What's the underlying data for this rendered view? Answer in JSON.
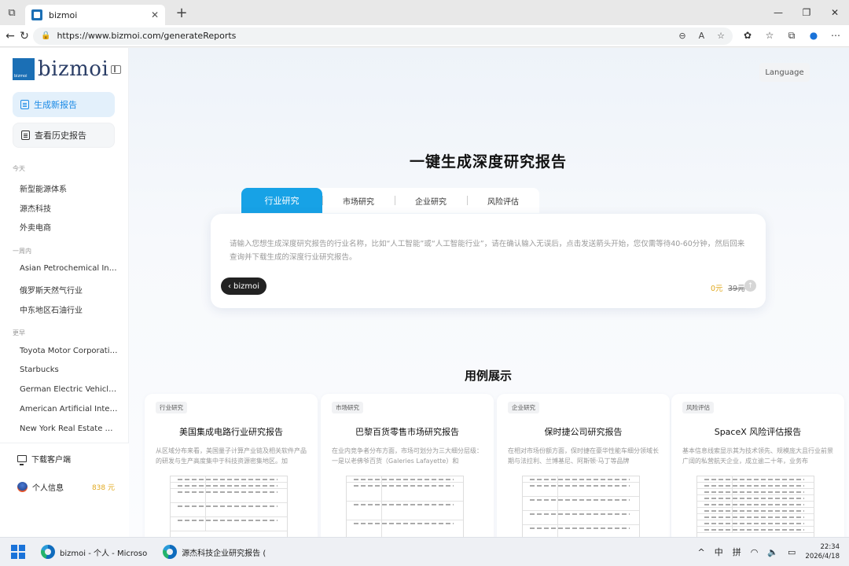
{
  "browser": {
    "tab_title": "bizmoi",
    "url": "https://www.bizmoi.com/generateReports"
  },
  "sidebar": {
    "logo_text": "bizmoi",
    "generate_button": "生成新报告",
    "history_button": "查看历史报告",
    "groups": [
      {
        "heading": "今天",
        "items": [
          "新型能源体系",
          "源杰科技",
          "外卖电商"
        ]
      },
      {
        "heading": "一周内",
        "items": [
          "Asian Petrochemical Industry",
          "俄罗斯天然气行业",
          "中东地区石油行业"
        ]
      },
      {
        "heading": "更早",
        "items": [
          "Toyota Motor Corporation",
          "Starbucks",
          "German Electric Vehicle Market",
          "American Artificial Intelligence",
          "New York Real Estate Market"
        ]
      }
    ],
    "download_client": "下载客户端",
    "user_label": "个人信息",
    "balance": "838 元"
  },
  "main": {
    "language_button": "Language",
    "title": "一键生成深度研究报告",
    "tabs": [
      {
        "label": "行业研究",
        "active": true
      },
      {
        "label": "市场研究",
        "active": false
      },
      {
        "label": "企业研究",
        "active": false
      },
      {
        "label": "风险评估",
        "active": false
      }
    ],
    "input_placeholder": "请输入您想生成深度研究报告的行业名称，比如“人工智能”或“人工智能行业”，请在确认输入无误后，点击发送箭头开始，您仅需等待40-60分钟，然后回来查询并下载生成的深度行业研究报告。",
    "brand_pill": "bizmoi",
    "price_current": "0元",
    "price_original": "39元",
    "send_icon": "arrow-up-icon"
  },
  "cases": {
    "title": "用例展示",
    "items": [
      {
        "tag": "行业研究",
        "title": "美国集成电路行业研究报告",
        "desc": "从区域分布来看，美国量子计算产业链及相关软件产品的研发与生产高度集中于科技资源密集地区。加"
      },
      {
        "tag": "市场研究",
        "title": "巴黎百货零售市场研究报告",
        "desc": "在业内竞争者分布方面，市场可划分为三大细分层级：一是以老佛爷百货（Galeries Lafayette）和"
      },
      {
        "tag": "企业研究",
        "title": "保时捷公司研究报告",
        "desc": "在相对市场份额方面，保时捷在豪华性能车细分领域长期与法拉利、兰博基尼、阿斯顿·马丁等品牌"
      },
      {
        "tag": "风险评估",
        "title": "SpaceX 风险评估报告",
        "desc": "基本信息线索显示其为技术领先、规模庞大且行业前景广阔的私营航天企业，成立逾二十年，业务布"
      }
    ]
  },
  "taskbar": {
    "app1": "bizmoi - 个人 - Microso",
    "app2": "源杰科技企业研究报告 (",
    "ime1": "中",
    "ime2": "拼",
    "time": "22:34",
    "date": "2026/4/18"
  }
}
